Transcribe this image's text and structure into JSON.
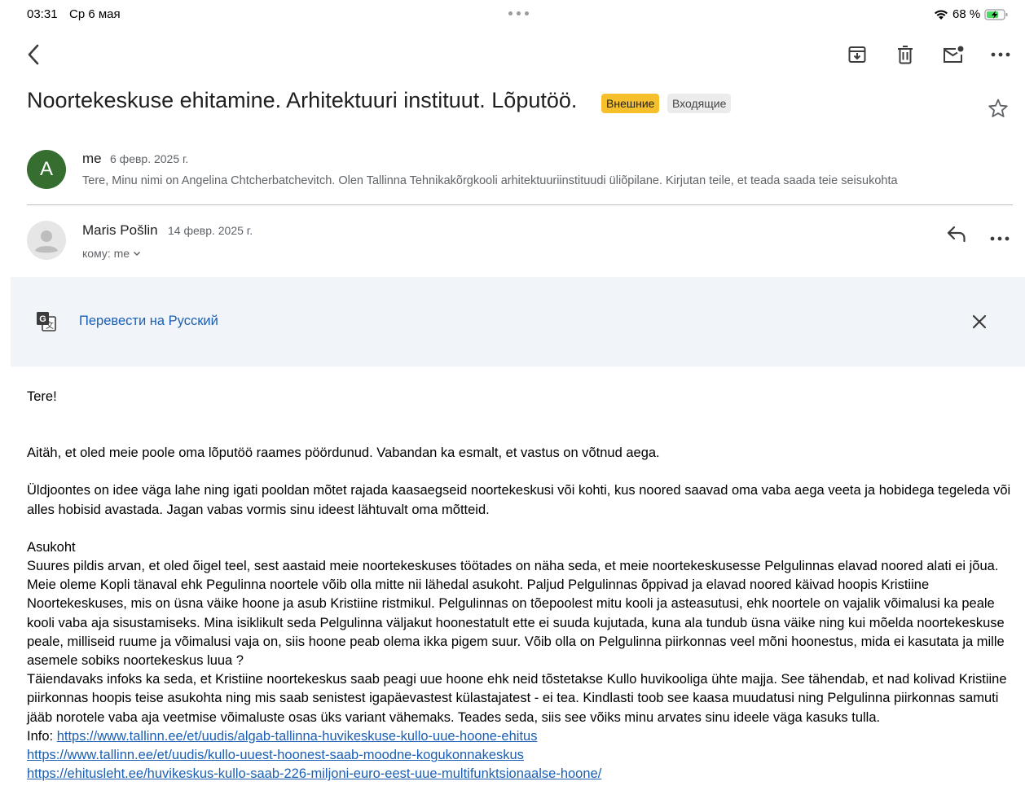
{
  "status_bar": {
    "time": "03:31",
    "date": "Ср 6 мая",
    "battery": "68 %"
  },
  "toolbar": {
    "back_icon": "chevron-left-icon",
    "archive_icon": "archive-icon",
    "delete_icon": "trash-icon",
    "mark_unread_icon": "mail-unread-icon",
    "more_icon": "more-horizontal-icon"
  },
  "email": {
    "subject": "Noortekeskuse ehitamine. Arhitektuuri instituut. Lõputöö.",
    "labels": [
      "Внешние",
      "Входящие"
    ],
    "star_icon": "star-outline-icon"
  },
  "message1": {
    "avatar_letter": "A",
    "sender": "me",
    "date": "6 февр. 2025 г.",
    "snippet": "Tere, Minu nimi on Angelina Chtcherbatchevitch. Olen Tallinna Tehnikakõrgkooli arhitektuuriinstituudi üliõpilane. Kirjutan teile, et teada saada teie seisukohta"
  },
  "message2": {
    "sender": "Maris Pošlin",
    "date": "14 февр. 2025 г.",
    "recipient": "кому: me",
    "reply_icon": "reply-icon",
    "more_icon": "more-horizontal-icon"
  },
  "translate": {
    "label": "Перевести на Русский",
    "icon": "google-translate-icon",
    "close_icon": "close-icon"
  },
  "body": {
    "greeting": "Tere!",
    "p1": "Aitäh, et oled meie poole oma lõputöö raames pöördunud. Vabandan ka esmalt, et vastus on võtnud aega.",
    "p2": "Üldjoontes on idee väga lahe ning igati pooldan mõtet rajada kaasaegseid noortekeskusi või kohti, kus noored saavad oma vaba aega veeta ja hobidega tegeleda või alles hobisid avastada. Jagan vabas vormis sinu ideest lähtuvalt oma mõtteid.",
    "heading": "Asukoht",
    "p3": "Suures pildis arvan, et oled õigel teel, sest aastaid meie noortekeskuses töötades on näha seda, et meie noortekeskusesse Pelgulinnas elavad noored alati ei jõua. Meie oleme Kopli tänaval ehk Pegulinna noortele võib olla mitte nii lähedal asukoht. Paljud Pelgulinnas õppivad ja elavad noored käivad hoopis Kristiine Noortekeskuses, mis on üsna väike hoone ja asub Kristiine ristmikul. Pelgulinnas on tõepoolest mitu kooli ja asteasutusi, ehk noortele on vajalik võimalusi ka peale kooli vaba aja sisustamiseks. Mina isiklikult seda Pelgulinna väljakut hoonestatult ette ei suuda kujutada, kuna ala tundub üsna väike ning kui mõelda noortekeskuse peale, milliseid ruume ja võimalusi vaja on, siis hoone peab olema ikka pigem suur. Võib olla on Pelgulinna piirkonnas veel mõni hoonestus, mida ei kasutata ja mille asemele sobiks noortekeskus luua ?",
    "p4": "Täiendavaks infoks ka seda, et Kristiine noortekeskus saab peagi uue hoone ehk neid tõstetakse Kullo huvikooliga ühte majja. See tähendab, et nad kolivad Kristiine piirkonnas hoopis teise asukohta ning mis saab senistest igapäevastest külastajatest - ei tea. Kindlasti toob see kaasa muudatusi ning Pelgulinna piirkonnas samuti jääb norotele vaba aja veetmise võimaluste osas üks variant vähemaks. Teades seda, siis see võiks minu arvates sinu ideele väga kasuks tulla.",
    "info_label": "Info: ",
    "links": [
      "https://www.tallinn.ee/et/uudis/algab-tallinna-huvikeskuse-kullo-uue-hoone-ehitus",
      "https://www.tallinn.ee/et/uudis/kullo-uuest-hoonest-saab-moodne-kogukonnakeskus",
      "https://ehitusleht.ee/huvikeskus-kullo-saab-226-miljoni-euro-eest-uue-multifunktsionaalse-hoone/"
    ]
  },
  "colors": {
    "accent_link": "#1a5fb4",
    "external_badge": "#f5c02c",
    "avatar_green": "#356e2f",
    "banner_bg": "#f1f4f9"
  }
}
